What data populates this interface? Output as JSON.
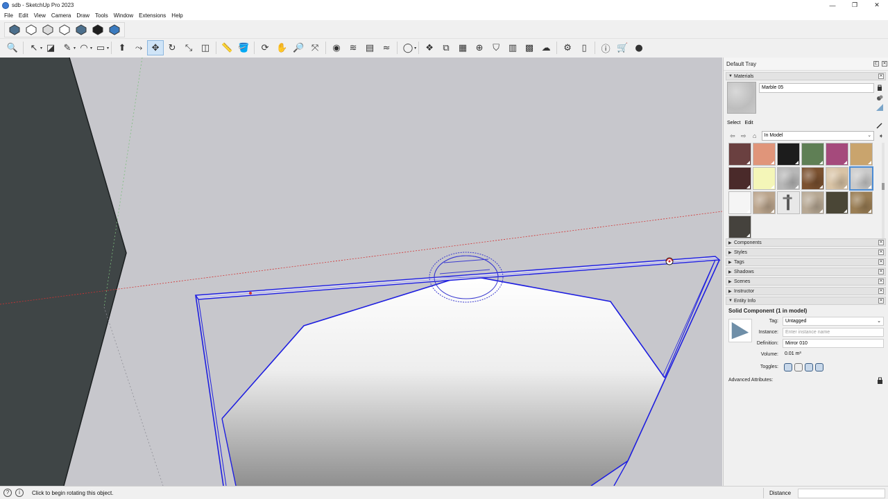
{
  "window": {
    "title": "sdb - SketchUp Pro 2023",
    "controls": [
      "—",
      "❐",
      "✕"
    ]
  },
  "menu": [
    "File",
    "Edit",
    "View",
    "Camera",
    "Draw",
    "Tools",
    "Window",
    "Extensions",
    "Help"
  ],
  "toolbar_views": [
    "iso-view-icon",
    "top-view-icon",
    "front-view-icon",
    "right-view-icon",
    "back-view-icon",
    "left-view-icon",
    "bottom-view-icon"
  ],
  "toolbar_main": [
    {
      "name": "zoom-extents-icon",
      "glyph": "🔍"
    },
    {
      "name": "select-tool-icon",
      "glyph": "↖",
      "dd": true
    },
    {
      "name": "eraser-tool-icon",
      "glyph": "◪"
    },
    {
      "name": "line-tool-icon",
      "glyph": "✎",
      "dd": true
    },
    {
      "name": "arc-tool-icon",
      "glyph": "◠",
      "dd": true
    },
    {
      "name": "shape-tool-icon",
      "glyph": "▭",
      "dd": true
    },
    {
      "name": "push-pull-tool-icon",
      "glyph": "⬆"
    },
    {
      "name": "follow-me-tool-icon",
      "glyph": "⤳"
    },
    {
      "name": "move-tool-icon",
      "glyph": "✥",
      "active": true
    },
    {
      "name": "rotate-tool-icon",
      "glyph": "↻"
    },
    {
      "name": "scale-tool-icon",
      "glyph": "⤡"
    },
    {
      "name": "offset-tool-icon",
      "glyph": "◫"
    },
    {
      "name": "tape-measure-tool-icon",
      "glyph": "📏"
    },
    {
      "name": "paint-bucket-tool-icon",
      "glyph": "🪣"
    },
    {
      "name": "orbit-tool-icon",
      "glyph": "⟳"
    },
    {
      "name": "pan-tool-icon",
      "glyph": "✋"
    },
    {
      "name": "zoom-tool-icon",
      "glyph": "🔎"
    },
    {
      "name": "zoom-window-icon",
      "glyph": "⤧"
    },
    {
      "name": "solid-outer-shell-icon",
      "glyph": "◉"
    },
    {
      "name": "sandbox-icon",
      "glyph": "≋"
    },
    {
      "name": "section-plane-icon",
      "glyph": "▤"
    },
    {
      "name": "terrain-icon",
      "glyph": "≈"
    },
    {
      "name": "user-account-icon",
      "glyph": "◯",
      "dd": true
    },
    {
      "name": "components-icon",
      "glyph": "❖"
    },
    {
      "name": "layout-icon",
      "glyph": "⧉"
    },
    {
      "name": "style-builder-icon",
      "glyph": "▦"
    },
    {
      "name": "add-location-icon",
      "glyph": "⊕"
    },
    {
      "name": "warehouse-icon",
      "glyph": "⛉"
    },
    {
      "name": "extension-warehouse-icon",
      "glyph": "▥"
    },
    {
      "name": "match-photo-icon",
      "glyph": "▩"
    },
    {
      "name": "trimble-connect-icon",
      "glyph": "☁"
    },
    {
      "name": "settings-icon",
      "glyph": "⚙"
    },
    {
      "name": "tray-icon",
      "glyph": "▯"
    },
    {
      "name": "info-icon",
      "glyph": "ⓘ"
    },
    {
      "name": "cart-icon",
      "glyph": "🛒"
    },
    {
      "name": "profile-icon",
      "glyph": "●"
    }
  ],
  "tray": {
    "title": "Default Tray",
    "materials": {
      "header": "Materials",
      "name": "Marble 05",
      "tabs": [
        "Select",
        "Edit"
      ],
      "collection": "In Model",
      "swatches": [
        {
          "color": "#6a4040",
          "pat": "solid"
        },
        {
          "color": "#e0957a",
          "pat": "solid"
        },
        {
          "color": "#1c1c1c",
          "pat": "solid"
        },
        {
          "color": "#5f7f55",
          "pat": "solid"
        },
        {
          "color": "#a54a7c",
          "pat": "solid"
        },
        {
          "color": "#c9a46d",
          "pat": "solid"
        },
        {
          "color": "#4a2a2a",
          "pat": "solid"
        },
        {
          "color": "#f4f6b8",
          "pat": "solid"
        },
        {
          "color": "#b7b7b7",
          "pat": "noise"
        },
        {
          "color": "#7b5130",
          "pat": "noise"
        },
        {
          "color": "#d8c3a5",
          "pat": "noise"
        },
        {
          "color": "#c9c9c9",
          "pat": "noise",
          "sel": true
        },
        {
          "color": "#f5f5f5",
          "pat": "solid"
        },
        {
          "color": "#bba58d",
          "pat": "noise"
        },
        {
          "color": "#e8e8e8",
          "pat": "faucet"
        },
        {
          "color": "#b7a894",
          "pat": "noise"
        },
        {
          "color": "#4a4636",
          "pat": "solid"
        },
        {
          "color": "#9a7e55",
          "pat": "noise"
        },
        {
          "color": "#45423d",
          "pat": "solid"
        }
      ]
    },
    "panels": [
      "Components",
      "Styles",
      "Tags",
      "Shadows",
      "Scenes",
      "Instructor"
    ],
    "entity_info": {
      "header": "Entity Info",
      "title": "Solid Component (1 in model)",
      "tag_label": "Tag:",
      "tag_value": "Untagged",
      "instance_label": "Instance:",
      "instance_placeholder": "Enter instance name",
      "definition_label": "Definition:",
      "definition_value": "Mirror 010",
      "volume_label": "Volume:",
      "volume_value": "0.01 m³",
      "toggles_label": "Toggles:",
      "advanced_label": "Advanced Attributes:"
    }
  },
  "status": {
    "message": "Click to begin rotating this object.",
    "measure_label": "Distance",
    "measure_value": ""
  },
  "colors": {
    "selection_blue": "#1e1ee0",
    "inference_red": "#d23232",
    "viewport_bg": "#c7c7cc",
    "wall_dark": "#3f4546"
  }
}
